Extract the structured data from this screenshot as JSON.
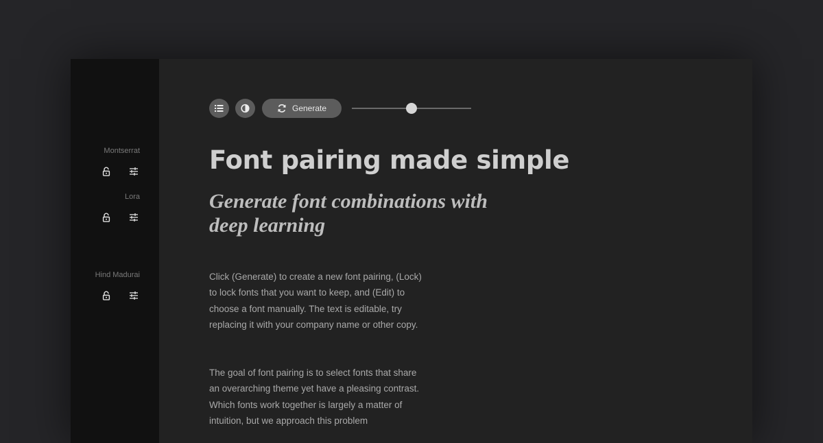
{
  "sidebar": {
    "fonts": [
      {
        "name": "Montserrat",
        "lock_icon": "lock-open-icon",
        "edit_icon": "sliders-icon"
      },
      {
        "name": "Lora",
        "lock_icon": "lock-open-icon",
        "edit_icon": "sliders-icon"
      },
      {
        "name": "Hind Madurai",
        "lock_icon": "lock-open-icon",
        "edit_icon": "sliders-icon"
      }
    ]
  },
  "toolbar": {
    "list_icon": "list-icon",
    "contrast_icon": "contrast-icon",
    "generate_icon": "refresh-icon",
    "generate_label": "Generate",
    "slider_value": 0.5
  },
  "content": {
    "headline": "Font pairing made simple",
    "subhead": "Generate font combinations with deep learning",
    "paragraph1": "Click (Generate) to create a new font pairing, (Lock) to lock fonts that you want to keep, and (Edit) to choose a font manually. The text is editable, try replacing it with your company name or other copy.",
    "paragraph2": "The goal of font pairing is to select fonts that share an overarching theme yet have a pleasing contrast. Which fonts work together is largely a matter of intuition, but we approach this problem"
  },
  "colors": {
    "page_bg": "#252528",
    "sidebar_bg": "#111111",
    "main_bg": "#222222",
    "button_bg": "#5c5c5c",
    "headline": "#cfcfcf"
  }
}
